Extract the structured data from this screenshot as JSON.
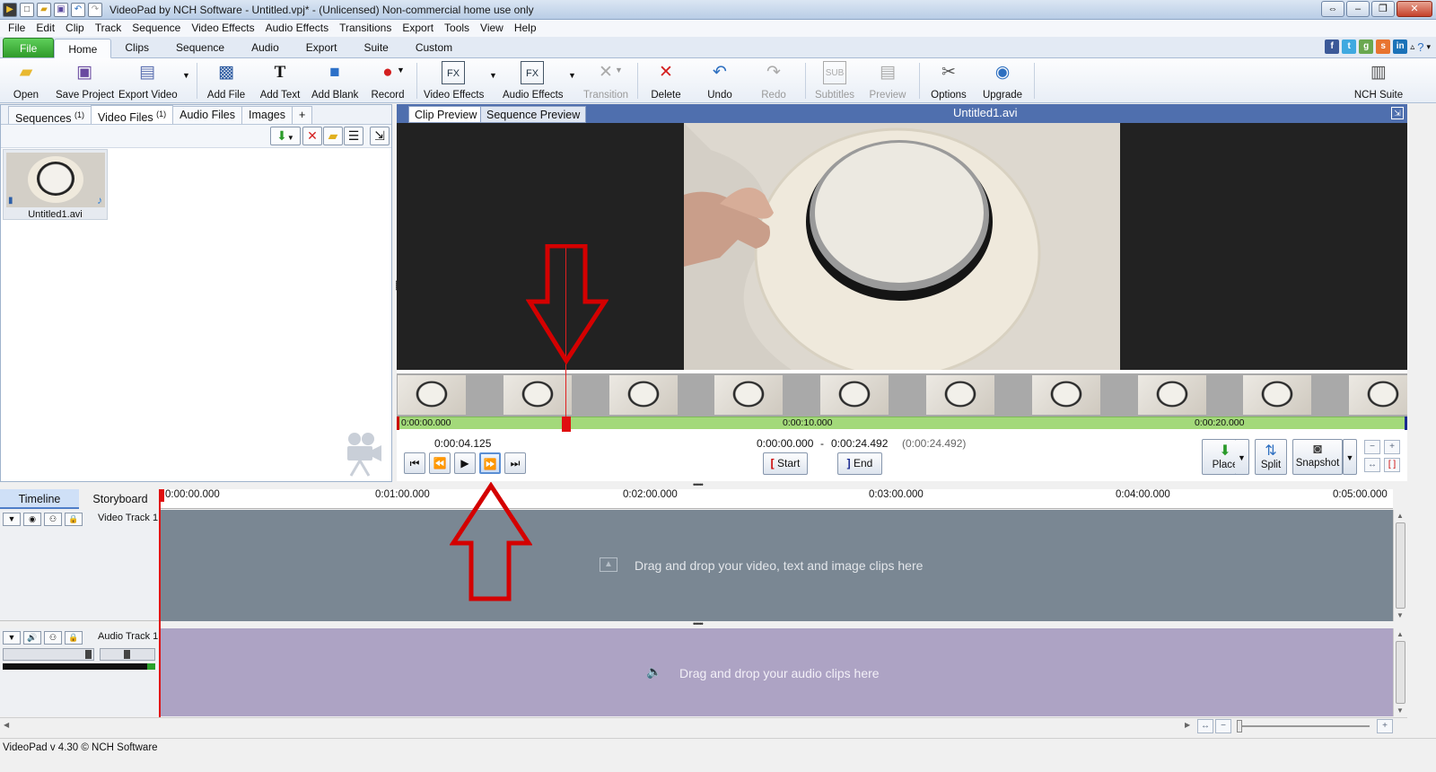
{
  "window": {
    "title": "VideoPad by NCH Software - Untitled.vpj* - (Unlicensed) Non-commercial home use only"
  },
  "menu": [
    "File",
    "Edit",
    "Clip",
    "Track",
    "Sequence",
    "Video Effects",
    "Audio Effects",
    "Transitions",
    "Export",
    "Tools",
    "View",
    "Help"
  ],
  "ribbon_tabs": [
    "File",
    "Home",
    "Clips",
    "Sequence",
    "Audio",
    "Export",
    "Suite",
    "Custom"
  ],
  "toolbar": {
    "open": "Open",
    "save_project": "Save Project",
    "export_video": "Export Video",
    "add_file": "Add File",
    "add_text": "Add Text",
    "add_blank": "Add Blank",
    "record": "Record",
    "video_effects": "Video Effects",
    "audio_effects": "Audio Effects",
    "transition": "Transition",
    "delete": "Delete",
    "undo": "Undo",
    "redo": "Redo",
    "subtitles": "Subtitles",
    "preview": "Preview",
    "options": "Options",
    "upgrade": "Upgrade",
    "nch_suite": "NCH Suite",
    "fx": "FX",
    "sub": "SUB"
  },
  "media_tabs": {
    "sequences": "Sequences",
    "sequences_count": "(1)",
    "video_files": "Video Files",
    "video_files_count": "(1)",
    "audio_files": "Audio Files",
    "images": "Images",
    "add": "+"
  },
  "media_bin": {
    "items": [
      {
        "name": "Untitled1.avi"
      }
    ]
  },
  "preview": {
    "clip_preview_tab": "Clip Preview",
    "sequence_preview_tab": "Sequence Preview",
    "clip_title": "Untitled1.avi",
    "scrub_ticks": [
      "0:00:00.000",
      "0:00:10.000",
      "0:00:20.000"
    ],
    "current_time": "0:00:04.125",
    "range_start": "0:00:00.000",
    "range_sep": "-",
    "range_end": "0:00:24.492",
    "range_duration": "(0:00:24.492)",
    "start_label": "Start",
    "end_label": "End",
    "place_label": "Place",
    "split_label": "Split",
    "snapshot_label": "Snapshot"
  },
  "timeline": {
    "tab_timeline": "Timeline",
    "tab_storyboard": "Storyboard",
    "ruler": [
      "0:00:00.000",
      "0:01:00.000",
      "0:02:00.000",
      "0:03:00.000",
      "0:04:00.000",
      "0:05:00.000"
    ],
    "video_track_name": "Video Track 1",
    "audio_track_name": "Audio Track 1",
    "video_hint": "Drag and drop your video, text and image clips here",
    "audio_hint": "Drag and drop your audio clips here"
  },
  "status": {
    "version": "VideoPad v 4.30 © NCH Software"
  },
  "colors": {
    "file_tab": "#2f9a2a",
    "preview_header": "#4f6fae",
    "scrub_bar": "#a3d97a",
    "video_lane": "#7a8793",
    "audio_lane": "#ada3c4",
    "playhead": "#e01010",
    "annotation_arrow": "#d40000"
  }
}
